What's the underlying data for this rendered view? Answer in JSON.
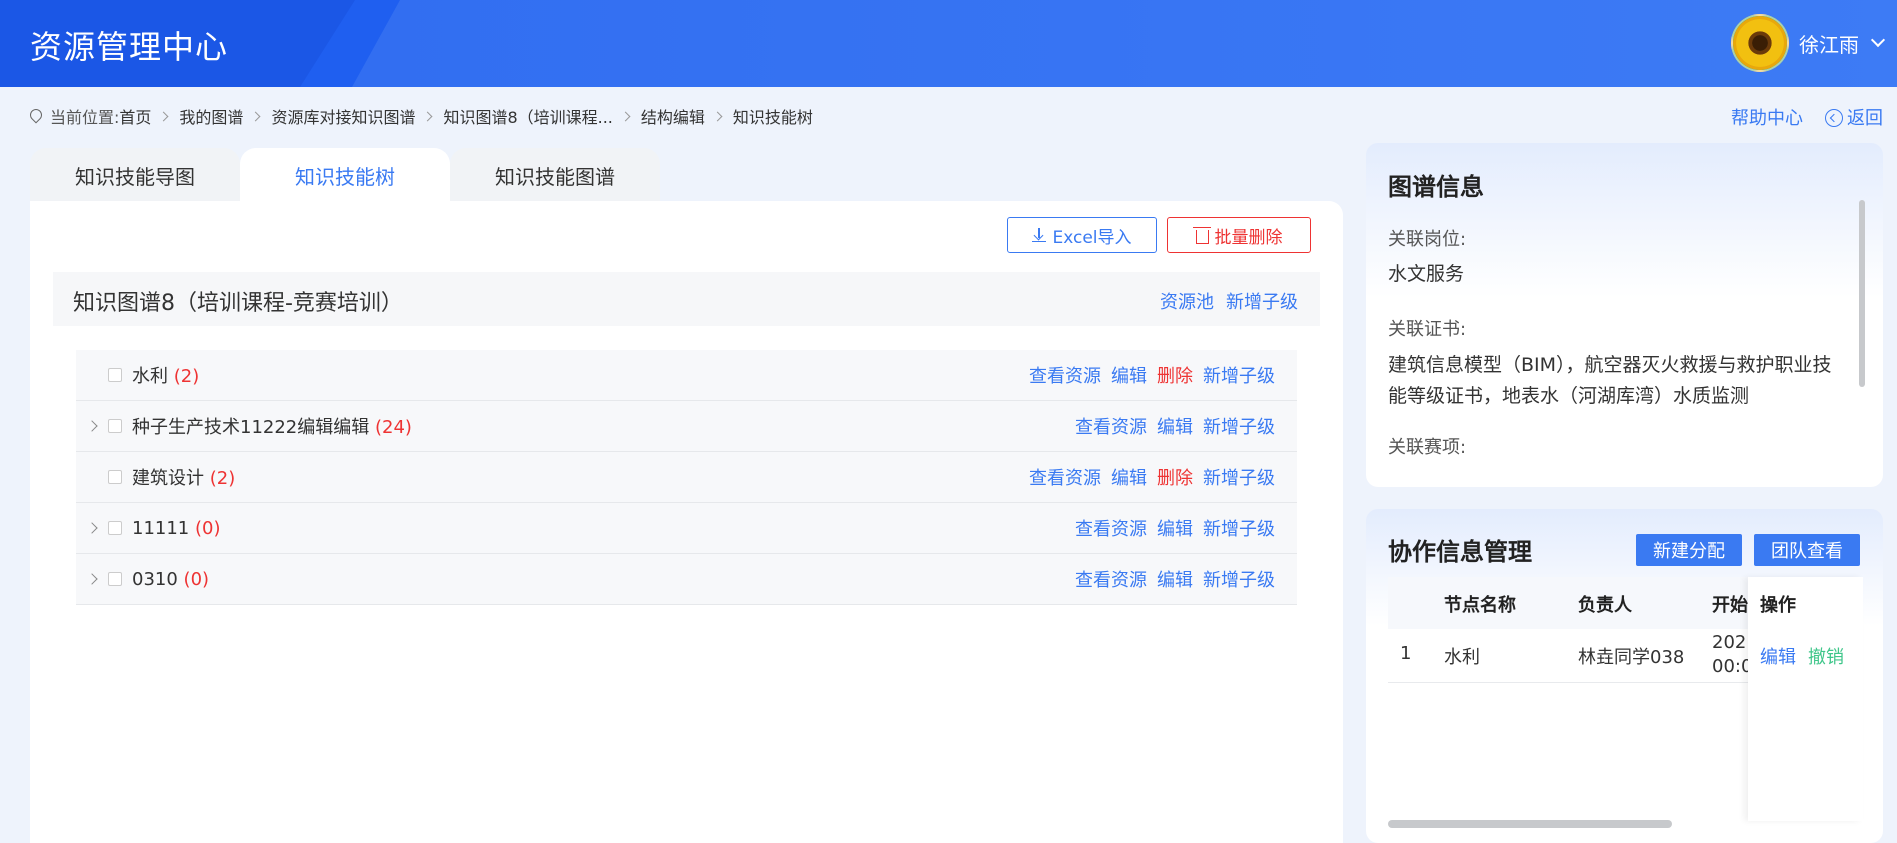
{
  "header": {
    "app_title": "资源管理中心",
    "user_name": "徐江雨"
  },
  "breadcrumb": {
    "prefix": "当前位置:",
    "items": [
      "首页",
      "我的图谱",
      "资源库对接知识图谱",
      "知识图谱8（培训课程...",
      "结构编辑",
      "知识技能树"
    ]
  },
  "top_links": {
    "help": "帮助中心",
    "back": "返回"
  },
  "tabs": [
    {
      "label": "知识技能导图",
      "active": false
    },
    {
      "label": "知识技能树",
      "active": true
    },
    {
      "label": "知识技能图谱",
      "active": false
    }
  ],
  "toolbar": {
    "excel_import": "Excel导入",
    "batch_delete": "批量删除"
  },
  "graph": {
    "title": "知识图谱8（培训课程-竞赛培训）",
    "resource_pool": "资源池",
    "add_child": "新增子级"
  },
  "tree_rows": [
    {
      "label": "水利",
      "count": "(2)",
      "expandable": false,
      "actions": [
        "查看资源",
        "编辑",
        "删除",
        "新增子级"
      ]
    },
    {
      "label": "种子生产技术11222编辑编辑",
      "count": "(24)",
      "expandable": true,
      "actions": [
        "查看资源",
        "编辑",
        "新增子级"
      ]
    },
    {
      "label": "建筑设计",
      "count": "(2)",
      "expandable": false,
      "actions": [
        "查看资源",
        "编辑",
        "删除",
        "新增子级"
      ]
    },
    {
      "label": "11111",
      "count": "(0)",
      "expandable": true,
      "actions": [
        "查看资源",
        "编辑",
        "新增子级"
      ]
    },
    {
      "label": "0310",
      "count": "(0)",
      "expandable": true,
      "actions": [
        "查看资源",
        "编辑",
        "新增子级"
      ]
    }
  ],
  "info_panel": {
    "heading": "图谱信息",
    "post_label": "关联岗位:",
    "post_value": "水文服务",
    "cert_label": "关联证书:",
    "cert_value": "建筑信息模型（BIM），航空器灭火救援与救护职业技能等级证书，地表水（河湖库湾）水质监测",
    "event_label": "关联赛项:"
  },
  "collab_panel": {
    "heading": "协作信息管理",
    "new_assign": "新建分配",
    "team_view": "团队查看",
    "columns": {
      "node": "节点名称",
      "owner": "负责人",
      "start": "开始",
      "op": "操作"
    },
    "rows": [
      {
        "index": "1",
        "node": "水利",
        "owner": "林垚同学038",
        "start_line1": "202",
        "start_line2": "00:0",
        "edit": "编辑",
        "revoke": "撤销"
      }
    ]
  },
  "colors": {
    "primary": "#3a7af2",
    "danger": "#ee3333",
    "success": "#3fc68a",
    "header": "#2f6bf0"
  }
}
